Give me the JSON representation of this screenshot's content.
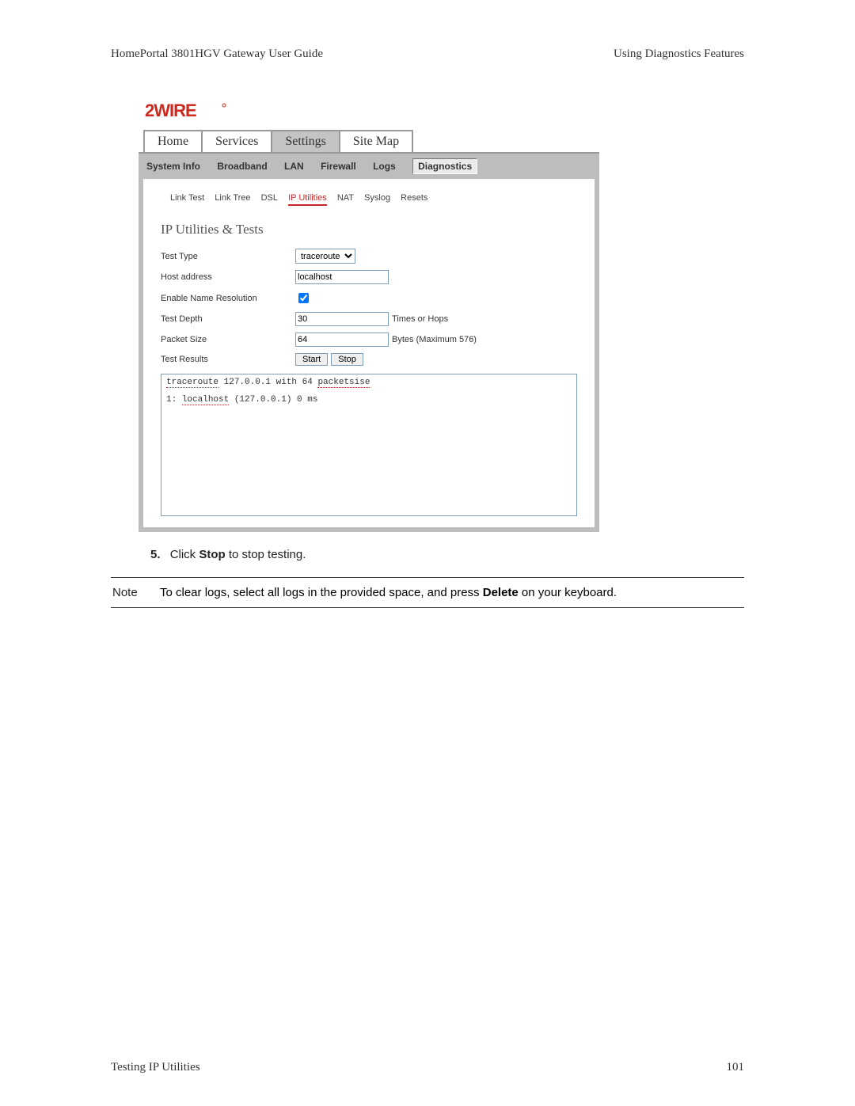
{
  "doc": {
    "header_left": "HomePortal 3801HGV Gateway User Guide",
    "header_right": "Using Diagnostics Features",
    "footer_left": "Testing IP Utilities",
    "footer_right": "101"
  },
  "logo_text": "2WIRE",
  "tabs": {
    "home": "Home",
    "services": "Services",
    "settings": "Settings",
    "sitemap": "Site Map"
  },
  "subnav": {
    "system_info": "System Info",
    "broadband": "Broadband",
    "lan": "LAN",
    "firewall": "Firewall",
    "logs": "Logs",
    "diagnostics": "Diagnostics"
  },
  "diag_links": {
    "link_test": "Link Test",
    "link_tree": "Link Tree",
    "dsl": "DSL",
    "ip_utilities": "IP Utilities",
    "nat": "NAT",
    "syslog": "Syslog",
    "resets": "Resets"
  },
  "section_title": "IP Utilities & Tests",
  "form": {
    "test_type": {
      "label": "Test Type",
      "value": "traceroute"
    },
    "host_address": {
      "label": "Host address",
      "value": "localhost"
    },
    "enable_name_res": {
      "label": "Enable Name Resolution"
    },
    "test_depth": {
      "label": "Test Depth",
      "value": "30",
      "suffix": "Times or Hops"
    },
    "packet_size": {
      "label": "Packet Size",
      "value": "64",
      "suffix": "Bytes (Maximum 576)"
    },
    "test_results": {
      "label": "Test Results",
      "start": "Start",
      "stop": "Stop"
    }
  },
  "results": {
    "line1a": "traceroute",
    "line1b": " 127.0.0.1 with 64 ",
    "line1c": "packetsise",
    "line2a": "1: ",
    "line2b": "localhost",
    "line2c": " (127.0.0.1) 0 ms"
  },
  "step": {
    "num": "5.",
    "pre": "Click ",
    "bold": "Stop",
    "post": " to stop testing."
  },
  "note": {
    "label": "Note",
    "pre": "To clear logs, select all logs in the provided space, and press ",
    "bold": "Delete",
    "post": " on your keyboard."
  }
}
